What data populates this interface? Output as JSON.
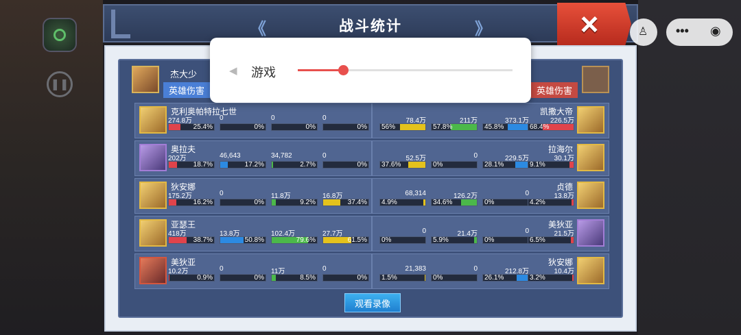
{
  "dialog": {
    "title": "战斗统计",
    "close_icon": "×",
    "replay_label": "观看录像"
  },
  "left_team": {
    "leader_name": "杰大少",
    "damage_label": "英雄伤害"
  },
  "right_team": {
    "damage_label": "英雄伤害"
  },
  "volume_popup": {
    "label": "游戏",
    "level": 0.21,
    "accent": "#e8504d"
  },
  "colors": {
    "red": "#e0434b",
    "blue": "#2c8ae2",
    "green": "#4bb84a",
    "yellow": "#e4c21c"
  },
  "left_rows": [
    {
      "name": "克利奥帕特拉七世",
      "avatar": "gold",
      "stats": [
        {
          "value": "274.8万",
          "pct": "25.4%",
          "p": 25.4,
          "color": "red"
        },
        {
          "value": "0",
          "pct": "0%",
          "p": 0,
          "color": "blue"
        },
        {
          "value": "0",
          "pct": "0%",
          "p": 0,
          "color": "green"
        },
        {
          "value": "0",
          "pct": "0%",
          "p": 0,
          "color": "yellow"
        }
      ]
    },
    {
      "name": "奥拉夫",
      "avatar": "purple",
      "stats": [
        {
          "value": "202万",
          "pct": "18.7%",
          "p": 18.7,
          "color": "red"
        },
        {
          "value": "46,643",
          "pct": "17.2%",
          "p": 17.2,
          "color": "blue"
        },
        {
          "value": "34,782",
          "pct": "2.7%",
          "p": 2.7,
          "color": "green"
        },
        {
          "value": "0",
          "pct": "0%",
          "p": 0,
          "color": "yellow"
        }
      ]
    },
    {
      "name": "狄安娜",
      "avatar": "gold",
      "stats": [
        {
          "value": "175.2万",
          "pct": "16.2%",
          "p": 16.2,
          "color": "red"
        },
        {
          "value": "0",
          "pct": "0%",
          "p": 0,
          "color": "blue"
        },
        {
          "value": "11.8万",
          "pct": "9.2%",
          "p": 9.2,
          "color": "green"
        },
        {
          "value": "16.8万",
          "pct": "37.4%",
          "p": 37.4,
          "color": "yellow"
        }
      ]
    },
    {
      "name": "亚瑟王",
      "avatar": "gold",
      "stats": [
        {
          "value": "418万",
          "pct": "38.7%",
          "p": 38.7,
          "color": "red"
        },
        {
          "value": "13.8万",
          "pct": "50.8%",
          "p": 50.8,
          "color": "blue"
        },
        {
          "value": "102.4万",
          "pct": "79.6%",
          "p": 79.6,
          "color": "green"
        },
        {
          "value": "27.7万",
          "pct": "61.5%",
          "p": 61.5,
          "color": "yellow"
        }
      ]
    },
    {
      "name": "美狄亚",
      "avatar": "red",
      "stats": [
        {
          "value": "10.2万",
          "pct": "0.9%",
          "p": 0.9,
          "color": "red"
        },
        {
          "value": "0",
          "pct": "0%",
          "p": 0,
          "color": "blue"
        },
        {
          "value": "11万",
          "pct": "8.5%",
          "p": 8.5,
          "color": "green"
        },
        {
          "value": "0",
          "pct": "0%",
          "p": 0,
          "color": "yellow"
        }
      ]
    }
  ],
  "right_rows": [
    {
      "name": "凯撒大帝",
      "avatar": "gold",
      "stats": [
        {
          "value": "78.4万",
          "pct": "56%",
          "p": 56,
          "color": "yellow"
        },
        {
          "value": "211万",
          "pct": "57.8%",
          "p": 57.8,
          "color": "green"
        },
        {
          "value": "373.1万",
          "pct": "45.8%",
          "p": 45.8,
          "color": "blue"
        },
        {
          "value": "226.5万",
          "pct": "68.4%",
          "p": 68.4,
          "color": "red"
        }
      ]
    },
    {
      "name": "拉海尔",
      "avatar": "gold",
      "stats": [
        {
          "value": "52.5万",
          "pct": "37.6%",
          "p": 37.6,
          "color": "yellow"
        },
        {
          "value": "0",
          "pct": "0%",
          "p": 0,
          "color": "green"
        },
        {
          "value": "229.5万",
          "pct": "28.1%",
          "p": 28.1,
          "color": "blue"
        },
        {
          "value": "30.1万",
          "pct": "9.1%",
          "p": 9.1,
          "color": "red"
        }
      ]
    },
    {
      "name": "贞德",
      "avatar": "gold",
      "stats": [
        {
          "value": "68,314",
          "pct": "4.9%",
          "p": 4.9,
          "color": "yellow"
        },
        {
          "value": "126.2万",
          "pct": "34.6%",
          "p": 34.6,
          "color": "green"
        },
        {
          "value": "0",
          "pct": "0%",
          "p": 0,
          "color": "blue"
        },
        {
          "value": "13.8万",
          "pct": "4.2%",
          "p": 4.2,
          "color": "red"
        }
      ]
    },
    {
      "name": "美狄亚",
      "avatar": "purple",
      "stats": [
        {
          "value": "0",
          "pct": "0%",
          "p": 0,
          "color": "yellow"
        },
        {
          "value": "21.4万",
          "pct": "5.9%",
          "p": 5.9,
          "color": "green"
        },
        {
          "value": "0",
          "pct": "0%",
          "p": 0,
          "color": "blue"
        },
        {
          "value": "21.5万",
          "pct": "6.5%",
          "p": 6.5,
          "color": "red"
        }
      ]
    },
    {
      "name": "狄安娜",
      "avatar": "gold",
      "stats": [
        {
          "value": "21,383",
          "pct": "1.5%",
          "p": 1.5,
          "color": "yellow"
        },
        {
          "value": "0",
          "pct": "0%",
          "p": 0,
          "color": "green"
        },
        {
          "value": "212.8万",
          "pct": "26.1%",
          "p": 26.1,
          "color": "blue"
        },
        {
          "value": "10.4万",
          "pct": "3.2%",
          "p": 3.2,
          "color": "red"
        }
      ]
    }
  ]
}
